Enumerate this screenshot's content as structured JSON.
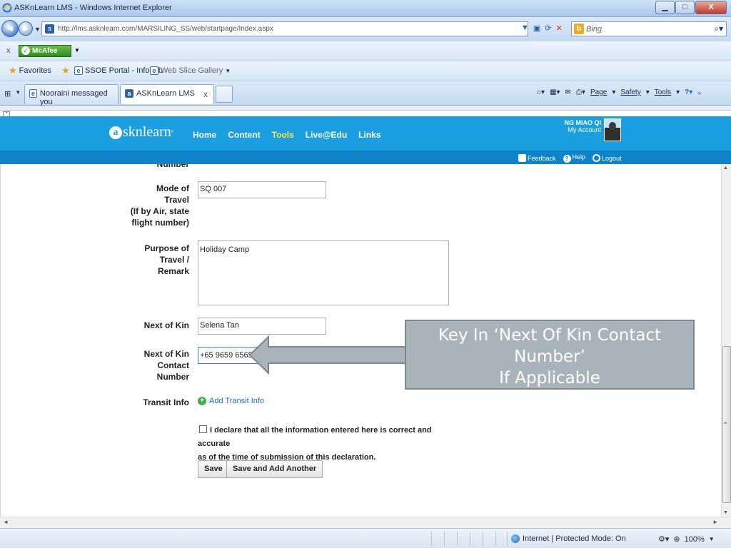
{
  "window": {
    "title": "ASKnLearn LMS - Windows Internet Explorer",
    "min": "▁",
    "max": "□",
    "close": "X"
  },
  "address_bar": {
    "back": "◄",
    "forward": "►",
    "url": "http://lms.asknlearn.com/MARSILING_SS/web/startpage/Index.aspx",
    "search_placeholder": "Bing"
  },
  "toolbar": {
    "close_x": "x",
    "mcafee_label": "McAfee"
  },
  "favorites": {
    "label": "Favorites",
    "items": [
      "SSOE Portal - Infohub",
      "Web Slice Gallery"
    ]
  },
  "tabs": [
    {
      "label": "Nooraini messaged you",
      "active": false
    },
    {
      "label": "ASKnLearn LMS",
      "active": true
    }
  ],
  "command_bar": {
    "page": "Page",
    "safety": "Safety",
    "tools": "Tools"
  },
  "site": {
    "logo_text": "sknlearn",
    "logo_letter": "a",
    "nav": [
      "Home",
      "Content",
      "Tools",
      "Live@Edu",
      "Links"
    ],
    "active_nav": "Tools",
    "user_name": "NG MIAO QI",
    "my_account": "My Account",
    "feedback": "Feedback",
    "help": "Help",
    "logout": "Logout"
  },
  "form": {
    "cut_label": "Number",
    "mode_of_travel": {
      "label_lines": [
        "Mode of",
        "Travel",
        "(If by Air, state",
        "flight number)"
      ],
      "value": "SQ 007"
    },
    "purpose": {
      "label_lines": [
        "Purpose of",
        "Travel /",
        "Remark"
      ],
      "value": "Holiday Camp"
    },
    "next_of_kin": {
      "label": "Next of Kin",
      "value": "Selena Tan"
    },
    "next_of_kin_contact": {
      "label_lines": [
        "Next of Kin",
        "Contact",
        "Number"
      ],
      "value": "+65 9659 6565"
    },
    "transit_info": {
      "label": "Transit Info",
      "link": "Add Transit Info"
    },
    "declaration": {
      "line1": "I declare that all the information entered here is correct and accurate",
      "line2": "as of the time of submission of this declaration."
    },
    "buttons": {
      "save": "Save",
      "save_and_add": "Save and Add Another"
    }
  },
  "callout": {
    "lines": [
      "Key In ‘Next Of Kin Contact",
      "Number’",
      "If Applicable"
    ]
  },
  "status_bar": {
    "zone": "Internet | Protected Mode: On",
    "zoom": "100%"
  },
  "colors": {
    "site_header": "#1b9fe0",
    "site_subbar": "#0f83c9",
    "active_nav": "#ffe34d",
    "callout_fill": "#a9b3ba"
  }
}
